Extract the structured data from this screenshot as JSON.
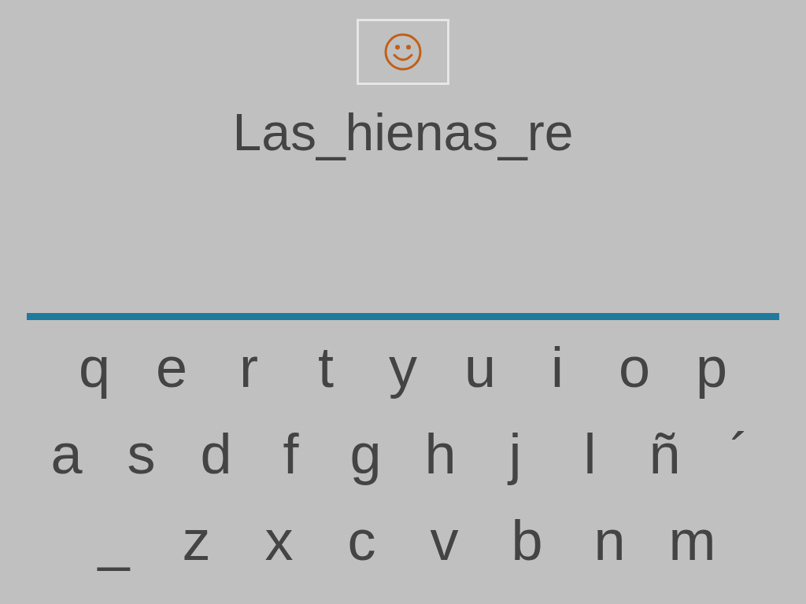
{
  "answer": {
    "text": "Las_hienas_re"
  },
  "keyboard": {
    "rows": [
      [
        "q",
        "e",
        "r",
        "t",
        "y",
        "u",
        "i",
        "o",
        "p"
      ],
      [
        "a",
        "s",
        "d",
        "f",
        "g",
        "h",
        "j",
        "l",
        "ñ",
        "´"
      ],
      [
        "_",
        "z",
        "x",
        "c",
        "v",
        "b",
        "n",
        "m"
      ]
    ]
  }
}
